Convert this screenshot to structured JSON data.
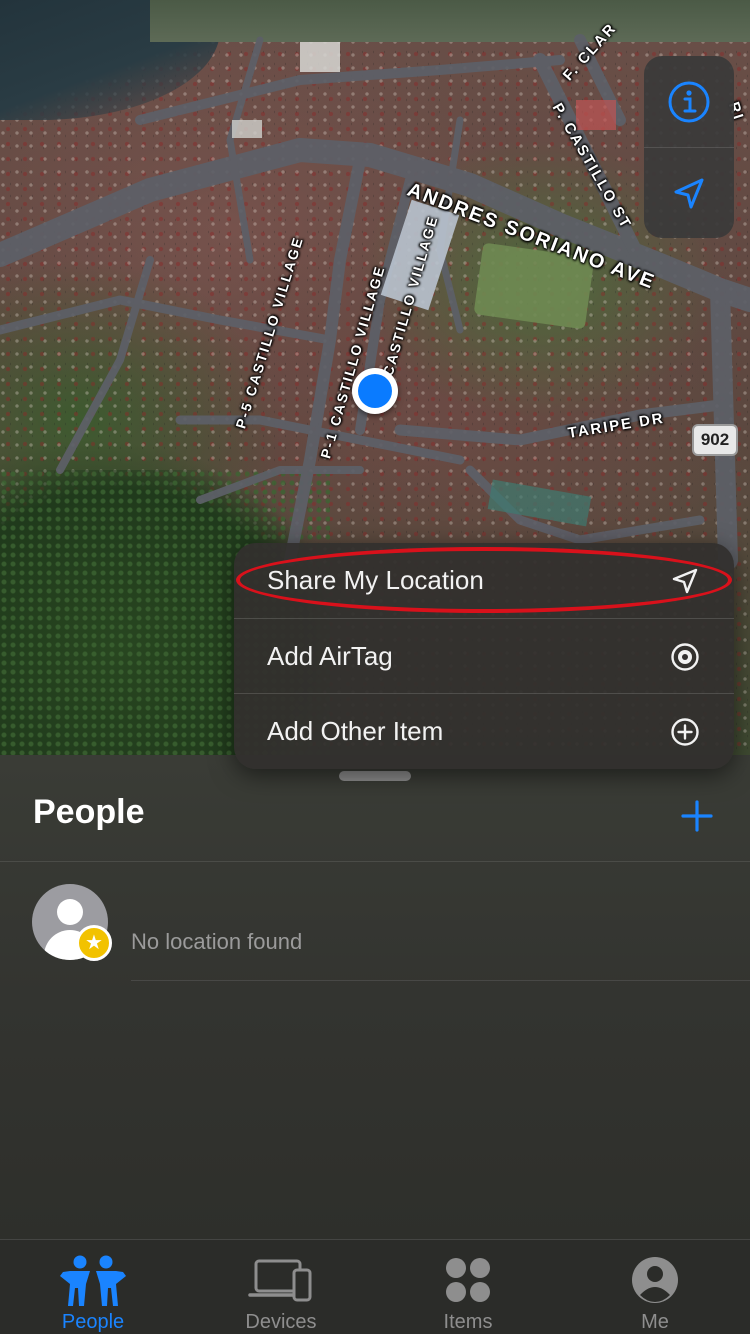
{
  "map": {
    "streets": [
      {
        "id": "andres",
        "label": "ANDRES SORIANO AVE"
      },
      {
        "id": "castillo-st",
        "label": "P. CASTILLO ST"
      },
      {
        "id": "clar",
        "label": "F. CLAR"
      },
      {
        "id": "ri",
        "label": "RI"
      },
      {
        "id": "p5",
        "label": "P-5 CASTILLO VILLAGE"
      },
      {
        "id": "p1a",
        "label": "P-1 CASTILLO VILLAGE"
      },
      {
        "id": "p1b",
        "label": "P-1 CASTILLO VILLAGE"
      },
      {
        "id": "taripe",
        "label": "TARIPE DR"
      }
    ],
    "route_shield": "902",
    "controls": {
      "info_icon": "info-circle-icon",
      "location_icon": "location-arrow-icon"
    }
  },
  "menu": {
    "items": [
      {
        "label": "Share My Location",
        "icon": "location-arrow-icon"
      },
      {
        "label": "Add AirTag",
        "icon": "airtag-icon"
      },
      {
        "label": "Add Other Item",
        "icon": "plus-circle-icon"
      }
    ],
    "highlight_color": "#d9111b"
  },
  "sheet": {
    "title": "People",
    "people": [
      {
        "status": "No location found"
      }
    ]
  },
  "tabbar": {
    "tabs": [
      {
        "label": "People",
        "active": true
      },
      {
        "label": "Devices",
        "active": false
      },
      {
        "label": "Items",
        "active": false
      },
      {
        "label": "Me",
        "active": false
      }
    ]
  },
  "colors": {
    "accent": "#1a84ff",
    "location_dot": "#0a7bff",
    "badge": "#f2c200"
  }
}
